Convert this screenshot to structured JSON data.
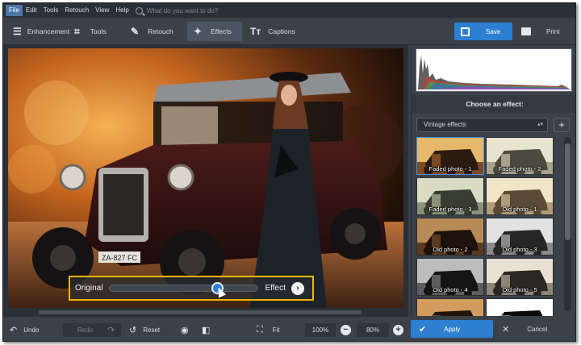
{
  "menu": {
    "items": [
      "File",
      "Edit",
      "Tools",
      "Retouch",
      "View",
      "Help"
    ],
    "active_index": 0,
    "search_placeholder": "What do you want to do?"
  },
  "toolbar": {
    "tabs": [
      {
        "label": "Enhancement",
        "icon": "sliders-icon"
      },
      {
        "label": "Tools",
        "icon": "crop-icon"
      },
      {
        "label": "Retouch",
        "icon": "brush-icon"
      },
      {
        "label": "Effects",
        "icon": "magic-wand-icon"
      },
      {
        "label": "Captions",
        "icon": "text-icon"
      }
    ],
    "active_tab": "Effects",
    "save_label": "Save",
    "print_label": "Print"
  },
  "compare": {
    "left_label": "Original",
    "right_label": "Effect",
    "slider_value": 0.75
  },
  "panel": {
    "choose_title": "Choose an effect:",
    "category": "Vintage effects",
    "effects": [
      {
        "label": "Faded photo - 1",
        "selected": true,
        "tone": "sepia"
      },
      {
        "label": "Faded photo - 2",
        "selected": false,
        "tone": "faded"
      },
      {
        "label": "Faded photo - 3",
        "selected": false,
        "tone": "faded-green"
      },
      {
        "label": "Old photo - 1",
        "selected": false,
        "tone": "warm-light"
      },
      {
        "label": "Old photo - 2",
        "selected": false,
        "tone": "dark-sepia"
      },
      {
        "label": "Old photo - 3",
        "selected": false,
        "tone": "bw"
      },
      {
        "label": "Old photo - 4",
        "selected": false,
        "tone": "bw-dark"
      },
      {
        "label": "Old photo - 5",
        "selected": false,
        "tone": "bw-warm"
      },
      {
        "label": "",
        "selected": false,
        "tone": "sepia-dark"
      },
      {
        "label": "",
        "selected": false,
        "tone": "bw-high"
      }
    ]
  },
  "bottombar": {
    "undo_label": "Undo",
    "redo_label": "Redo",
    "reset_label": "Reset",
    "fit_label": "Fit",
    "zoom_100": "100%",
    "zoom_current": "80%",
    "apply_label": "Apply",
    "cancel_label": "Cancel"
  },
  "colors": {
    "accent": "#2d7fd2",
    "highlight": "#f4b400",
    "chrome": "#3a4149"
  }
}
